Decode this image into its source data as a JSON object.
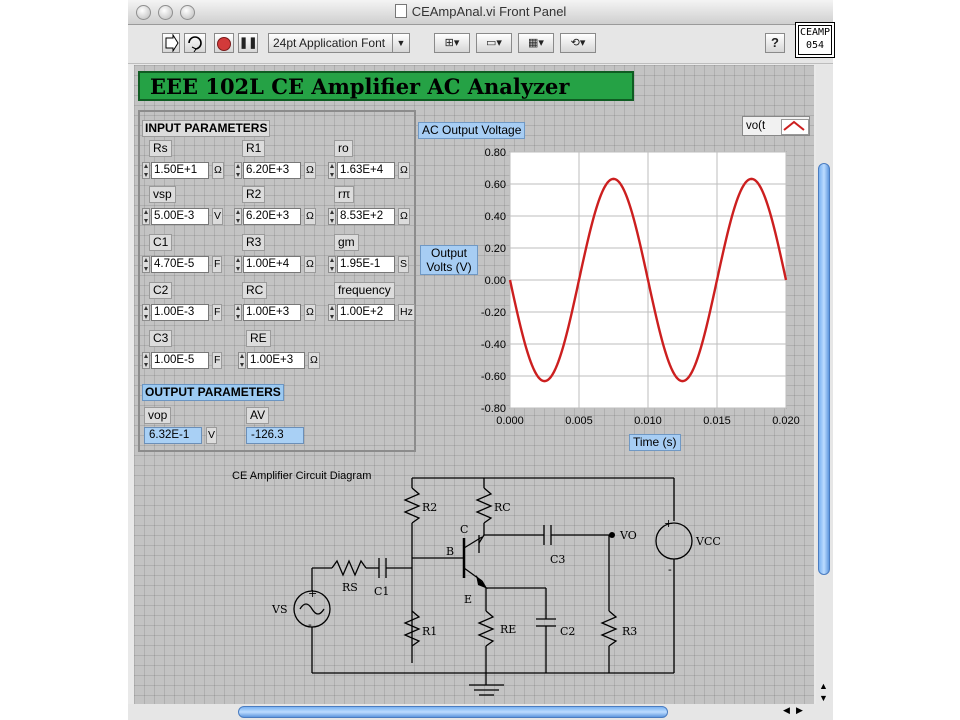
{
  "window": {
    "title": "CEAmpAnal.vi Front Panel"
  },
  "toolbar": {
    "font_select": "24pt Application Font",
    "help_label": "?"
  },
  "connector": {
    "line1": "CEAMP",
    "line2": "054"
  },
  "app_title": "EEE 102L CE Amplifier AC Analyzer",
  "input_section": {
    "title": "INPUT PARAMETERS",
    "params": [
      {
        "id": "rs",
        "label": "Rs",
        "value": "1.50E+1",
        "unit": "Ω"
      },
      {
        "id": "r1",
        "label": "R1",
        "value": "6.20E+3",
        "unit": "Ω"
      },
      {
        "id": "ro",
        "label": "ro",
        "value": "1.63E+4",
        "unit": "Ω"
      },
      {
        "id": "vsp",
        "label": "vsp",
        "value": "5.00E-3",
        "unit": "V"
      },
      {
        "id": "r2",
        "label": "R2",
        "value": "6.20E+3",
        "unit": "Ω"
      },
      {
        "id": "rpi",
        "label": "rπ",
        "value": "8.53E+2",
        "unit": "Ω"
      },
      {
        "id": "c1",
        "label": "C1",
        "value": "4.70E-5",
        "unit": "F"
      },
      {
        "id": "r3",
        "label": "R3",
        "value": "1.00E+4",
        "unit": "Ω"
      },
      {
        "id": "gm",
        "label": "gm",
        "value": "1.95E-1",
        "unit": "S"
      },
      {
        "id": "c2",
        "label": "C2",
        "value": "1.00E-3",
        "unit": "F"
      },
      {
        "id": "rc",
        "label": "RC",
        "value": "1.00E+3",
        "unit": "Ω"
      },
      {
        "id": "frequency",
        "label": "frequency",
        "value": "1.00E+2",
        "unit": "Hz"
      },
      {
        "id": "c3",
        "label": "C3",
        "value": "1.00E-5",
        "unit": "F"
      },
      {
        "id": "re",
        "label": "RE",
        "value": "1.00E+3",
        "unit": "Ω"
      }
    ]
  },
  "output_section": {
    "title": "OUTPUT PARAMETERS",
    "vop": {
      "label": "vop",
      "value": "6.32E-1",
      "unit": "V"
    },
    "av": {
      "label": "AV",
      "value": "-126.3"
    }
  },
  "chart_data": {
    "type": "line",
    "title": "AC Output Voltage",
    "xlabel": "Time (s)",
    "ylabel": "Output Volts (V)",
    "xlim": [
      0,
      0.02
    ],
    "ylim": [
      -0.8,
      0.8
    ],
    "xticks": [
      "0.000",
      "0.005",
      "0.010",
      "0.015",
      "0.020"
    ],
    "yticks": [
      "0.80",
      "0.60",
      "0.40",
      "0.20",
      "0.00",
      "-0.20",
      "-0.40",
      "-0.60",
      "-0.80"
    ],
    "grid": true,
    "legend": "top-right",
    "series": [
      {
        "name": "vo(t",
        "color": "#cc1f1f",
        "amplitude": 0.632,
        "frequency_hz": 100,
        "phase": "inverted sine",
        "function": "-0.632*sin(2*pi*100*t)"
      }
    ]
  },
  "diagram": {
    "title": "CE Amplifier Circuit Diagram",
    "labels": {
      "r2": "R2",
      "rc": "RC",
      "c": "C",
      "c3": "C3",
      "vo": "VO",
      "vcc": "VCC",
      "rs": "RS",
      "c1": "C1",
      "b": "B",
      "e": "E",
      "vs": "VS",
      "r1": "R1",
      "re": "RE",
      "c2": "C2",
      "r3": "R3",
      "plus": "+",
      "minus": "-"
    }
  }
}
